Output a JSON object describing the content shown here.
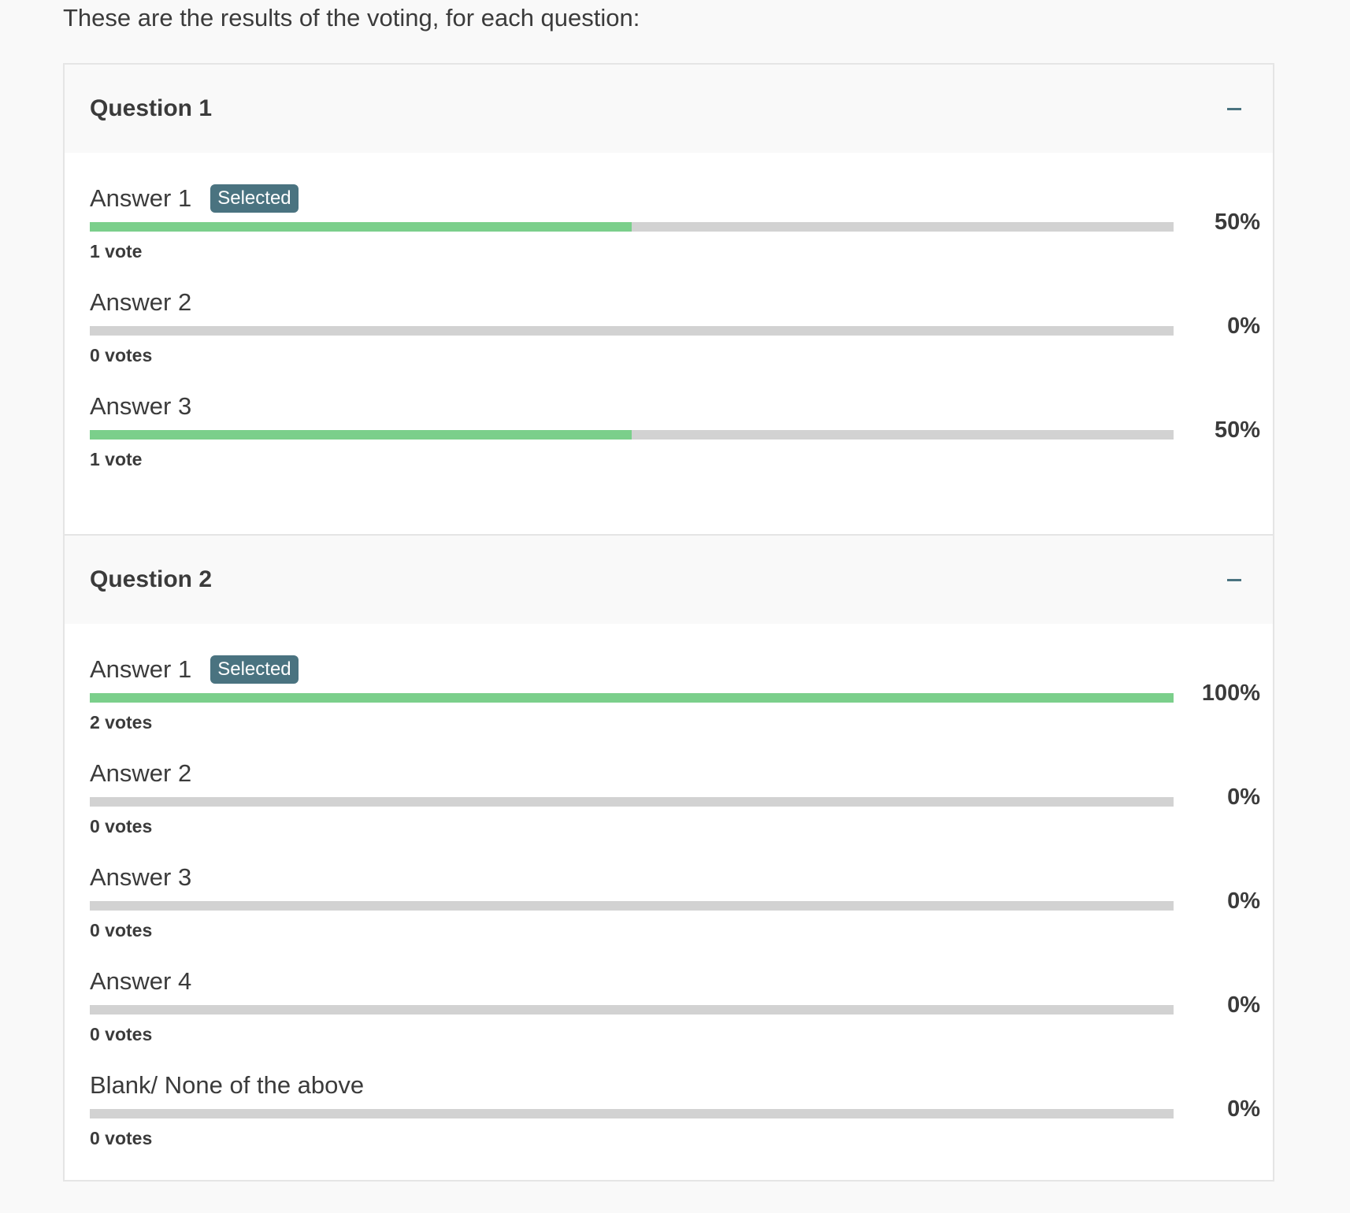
{
  "intro_text": "These are the results of the voting, for each question:",
  "colors": {
    "fill": "#7bcf8b",
    "track": "#d2d2d2",
    "badge": "#4a7380",
    "header_bg": "#f9f9f9"
  },
  "questions": [
    {
      "title": "Question 1",
      "toggle_icon": "minus-icon",
      "answers": [
        {
          "label": "Answer 1",
          "selected": true,
          "badge": "Selected",
          "votes": "1 vote",
          "percent_label": "50%",
          "fraction": 0.5
        },
        {
          "label": "Answer 2",
          "selected": false,
          "badge": "",
          "votes": "0 votes",
          "percent_label": "0%",
          "fraction": 0
        },
        {
          "label": "Answer 3",
          "selected": false,
          "badge": "",
          "votes": "1 vote",
          "percent_label": "50%",
          "fraction": 0.5
        }
      ]
    },
    {
      "title": "Question 2",
      "toggle_icon": "minus-icon",
      "answers": [
        {
          "label": "Answer 1",
          "selected": true,
          "badge": "Selected",
          "votes": "2 votes",
          "percent_label": "100%",
          "fraction": 1
        },
        {
          "label": "Answer 2",
          "selected": false,
          "badge": "",
          "votes": "0 votes",
          "percent_label": "0%",
          "fraction": 0
        },
        {
          "label": "Answer 3",
          "selected": false,
          "badge": "",
          "votes": "0 votes",
          "percent_label": "0%",
          "fraction": 0
        },
        {
          "label": "Answer 4",
          "selected": false,
          "badge": "",
          "votes": "0 votes",
          "percent_label": "0%",
          "fraction": 0
        },
        {
          "label": "Blank/ None of the above",
          "selected": false,
          "badge": "",
          "votes": "0 votes",
          "percent_label": "0%",
          "fraction": 0
        }
      ]
    }
  ]
}
